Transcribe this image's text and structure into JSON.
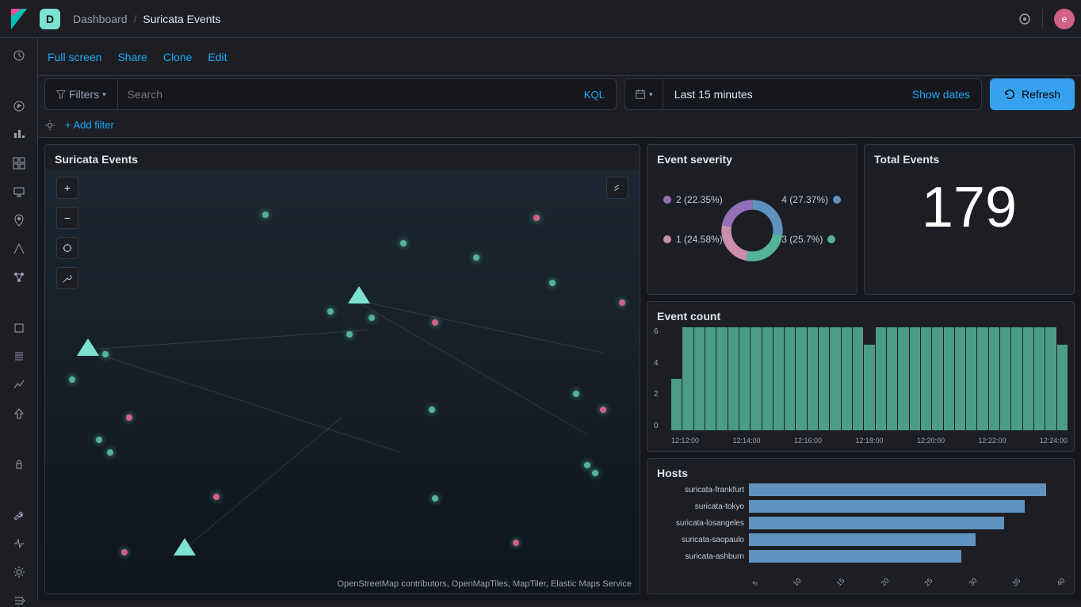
{
  "header": {
    "space_letter": "D",
    "breadcrumb_root": "Dashboard",
    "breadcrumb_current": "Suricata Events",
    "avatar_letter": "e"
  },
  "subheader": {
    "full_screen": "Full screen",
    "share": "Share",
    "clone": "Clone",
    "edit": "Edit"
  },
  "search": {
    "filters_label": "Filters",
    "search_placeholder": "Search",
    "kql_label": "KQL",
    "date_range": "Last 15 minutes",
    "show_dates": "Show dates",
    "refresh": "Refresh"
  },
  "filter_row": {
    "add_filter": "+ Add filter"
  },
  "panels": {
    "map": {
      "title": "Suricata Events",
      "attribution": "OpenStreetMap contributors, OpenMapTiles, MapTiler, Elastic Maps Service"
    },
    "severity": {
      "title": "Event severity",
      "legend": {
        "two": "2 (22.35%)",
        "one": "1 (24.58%)",
        "four": "4 (27.37%)",
        "three": "3 (25.7%)"
      }
    },
    "total": {
      "title": "Total Events",
      "value": "179"
    },
    "count": {
      "title": "Event count",
      "y_labels": [
        "6",
        "4",
        "2",
        "0"
      ],
      "x_labels": [
        "12:12:00",
        "12:14:00",
        "12:16:00",
        "12:18:00",
        "12:20:00",
        "12:22:00",
        "12:24:00"
      ]
    },
    "hosts": {
      "title": "Hosts",
      "rows": [
        {
          "label": "suricata-frankfurt"
        },
        {
          "label": "suricata-tokyo"
        },
        {
          "label": "suricata-losangeles"
        },
        {
          "label": "suricata-saopaulo"
        },
        {
          "label": "suricata-ashburn"
        }
      ],
      "x_labels": [
        "5",
        "10",
        "15",
        "20",
        "25",
        "30",
        "35",
        "40"
      ]
    }
  },
  "colors": {
    "severity_two": "#9170B8",
    "severity_one": "#CA8EAE",
    "severity_four": "#6092C0",
    "severity_three": "#54B399"
  },
  "chart_data": [
    {
      "type": "pie",
      "title": "Event severity",
      "series": [
        {
          "name": "2",
          "value": 22.35
        },
        {
          "name": "1",
          "value": 24.58
        },
        {
          "name": "4",
          "value": 27.37
        },
        {
          "name": "3",
          "value": 25.7
        }
      ]
    },
    {
      "type": "bar",
      "title": "Event count",
      "xlabel": "",
      "ylabel": "",
      "ylim": [
        0,
        6
      ],
      "categories": [
        "12:12:00",
        "12:14:00",
        "12:16:00",
        "12:18:00",
        "12:20:00",
        "12:22:00",
        "12:24:00"
      ],
      "values": [
        3,
        6,
        6,
        6,
        6,
        6,
        6,
        6,
        6,
        6,
        6,
        6,
        6,
        6,
        6,
        6,
        6,
        5,
        6,
        6,
        6,
        6,
        6,
        6,
        6,
        6,
        6,
        6,
        6,
        6,
        6,
        6,
        6,
        6,
        5
      ]
    },
    {
      "type": "bar",
      "title": "Hosts",
      "xlabel": "",
      "ylabel": "",
      "xlim": [
        0,
        45
      ],
      "categories": [
        "suricata-frankfurt",
        "suricata-tokyo",
        "suricata-losangeles",
        "suricata-saopaulo",
        "suricata-ashburn"
      ],
      "values": [
        42,
        39,
        36,
        32,
        30
      ]
    },
    {
      "type": "table",
      "title": "Total Events",
      "values": [
        179
      ]
    }
  ]
}
